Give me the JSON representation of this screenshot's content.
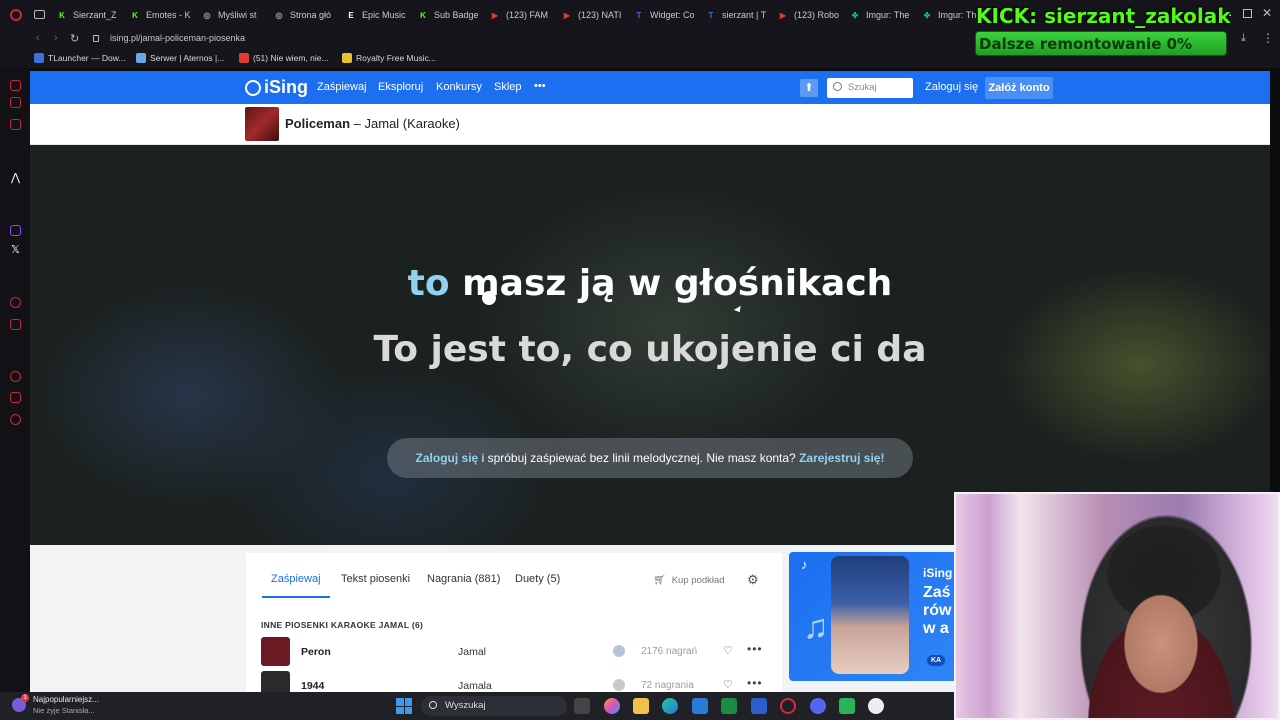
{
  "browser": {
    "tabs": [
      {
        "label": "Sierzant_Z",
        "color": "#53fc18",
        "glyph": "K"
      },
      {
        "label": "Emotes - K",
        "color": "#53fc18",
        "glyph": "K"
      },
      {
        "label": "Myśliwi st",
        "color": "#aaaaaa",
        "glyph": "◎"
      },
      {
        "label": "Strona głó",
        "color": "#aaaaaa",
        "glyph": "◎"
      },
      {
        "label": "Epic Music",
        "color": "#ffffff",
        "glyph": "E"
      },
      {
        "label": "Sub Badge",
        "color": "#53fc18",
        "glyph": "K"
      },
      {
        "label": "(123) FAM",
        "color": "#e53935",
        "glyph": "▶"
      },
      {
        "label": "(123) NATI",
        "color": "#e53935",
        "glyph": "▶"
      },
      {
        "label": "Widget: Co",
        "color": "#3f6fd8",
        "glyph": "T"
      },
      {
        "label": "sierzant | T",
        "color": "#3f6fd8",
        "glyph": "T"
      },
      {
        "label": "(123) Robo",
        "color": "#e53935",
        "glyph": "▶"
      },
      {
        "label": "Imgur: The",
        "color": "#1bb76e",
        "glyph": "✤"
      },
      {
        "label": "Imgur: The",
        "color": "#1bb76e",
        "glyph": "✤"
      }
    ],
    "url": "ising.pl/jamal-policeman-piosenka",
    "bookmarks": [
      {
        "label": "TLauncher — Dow...",
        "color": "#3f6fd8"
      },
      {
        "label": "Serwer | Aternos |...",
        "color": "#6aa6e8"
      },
      {
        "label": "(51) Nie wiem, nie...",
        "color": "#e53935"
      },
      {
        "label": "Royalty Free Music...",
        "color": "#e8c22b"
      }
    ]
  },
  "overlay": {
    "kick_title": "KICK: sierzant_zakolak",
    "goal_text": "Dalsze remontowanie 0%",
    "goal_progress": 0
  },
  "site": {
    "logo": "iSing",
    "nav": [
      "Zaśpiewaj",
      "Eksploruj",
      "Konkursy",
      "Sklep"
    ],
    "more_label": "•••",
    "search_placeholder": "Szukaj",
    "login_label": "Zaloguj się",
    "signup_label": "Załóż konto",
    "song_title": "Policeman",
    "song_dash": "–",
    "song_artist": "Jamal (Karaoke)"
  },
  "karaoke": {
    "line1_sung": "to",
    "line1_rest": "masz ją w głośnikach",
    "line2": "To jest to, co ukojenie ci da",
    "banner_login": "Zaloguj się",
    "banner_text": "i spróbuj zaśpiewać bez linii melodycznej. Nie masz konta?",
    "banner_register": "Zarejestruj się!"
  },
  "song_tabs": [
    "Zaśpiewaj",
    "Tekst piosenki",
    "Nagrania (881)",
    "Duety (5)"
  ],
  "buy_label": "Kup podkład",
  "other_songs": {
    "heading": "INNE PIOSENKI KARAOKE JAMAL (6)",
    "rows": [
      {
        "title": "Peron",
        "artist": "Jamal",
        "count": "2176 nagrań"
      },
      {
        "title": "1944",
        "artist": "Jamala",
        "count": "72 nagrania"
      }
    ]
  },
  "ad": {
    "brand": "iSing",
    "big_text": "Zaś\nrów\nw a",
    "badge": "KA"
  },
  "taskbar": {
    "notif_title": "Najpopularniejsz...",
    "notif_sub": "Nie żyje Stanisła...",
    "notif_badge": "3",
    "search_label": "Wyszukaj"
  }
}
